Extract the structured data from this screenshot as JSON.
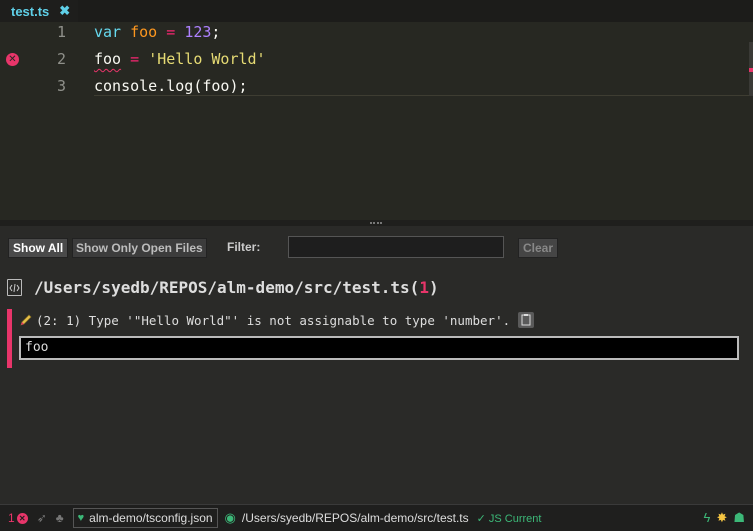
{
  "tab": {
    "label": "test.ts",
    "close": "✖"
  },
  "editor": {
    "lines": [
      {
        "number": "1",
        "tokens": [
          [
            "kw",
            "var"
          ],
          [
            "plain",
            " "
          ],
          [
            "var",
            "foo"
          ],
          [
            "plain",
            " "
          ],
          [
            "op",
            "="
          ],
          [
            "plain",
            " "
          ],
          [
            "num",
            "123"
          ],
          [
            "plain",
            ";"
          ]
        ]
      },
      {
        "number": "2",
        "error": true,
        "tokens": [
          [
            "plain",
            "foo"
          ],
          [
            "plain",
            " "
          ],
          [
            "op",
            "="
          ],
          [
            "plain",
            " "
          ],
          [
            "str",
            "'Hello World'"
          ]
        ]
      },
      {
        "number": "3",
        "tokens": [
          [
            "plain",
            "console.log(foo);"
          ]
        ]
      }
    ]
  },
  "errors_panel": {
    "show_all": "Show All",
    "show_open": "Show Only Open Files",
    "filter_label": "Filter:",
    "filter_value": "",
    "clear": "Clear",
    "file_path": "/Users/syedb/REPOS/alm-demo/src/test.ts(",
    "file_count": "1",
    "file_close": ")",
    "error_message": "(2: 1) Type '\"Hello World\"' is not assignable to type 'number'.",
    "snippet": "foo"
  },
  "statusbar": {
    "error_count": "1",
    "project": "alm-demo/tsconfig.json",
    "active_file": "/Users/syedb/REPOS/alm-demo/src/test.ts",
    "js_status": "✓ JS Current"
  },
  "colors": {
    "error": "#e8356a",
    "accent_cyan": "#5fd0e8",
    "green": "#3cb878"
  },
  "icons": [
    "close-icon",
    "error-icon",
    "file-code-icon",
    "pencil-icon",
    "copy-icon",
    "rocket-icon",
    "tree-icon",
    "heart-icon",
    "eye-icon",
    "lightning-icon",
    "sun-icon",
    "bug-icon"
  ]
}
